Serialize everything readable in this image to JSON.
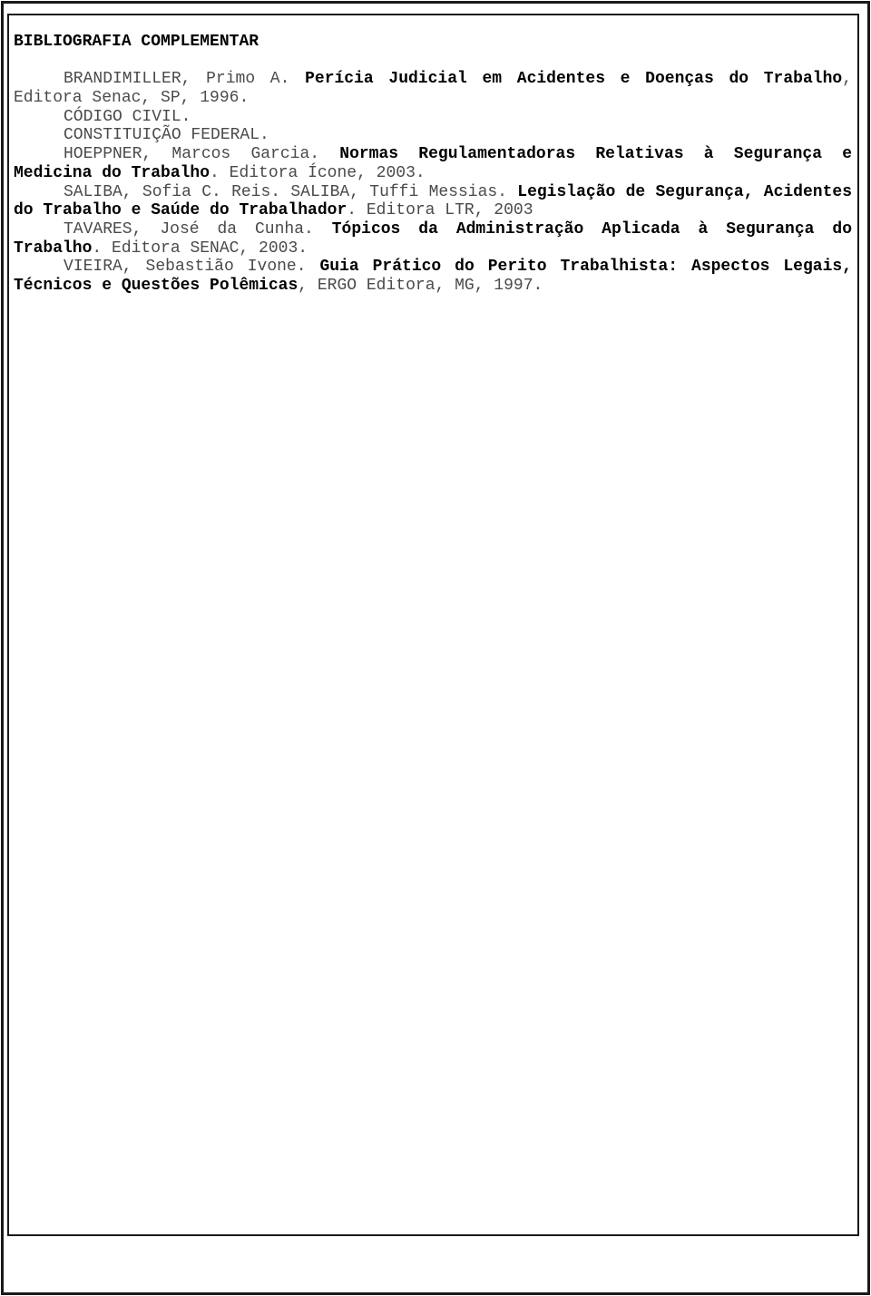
{
  "document": {
    "section_title": "BIBLIOGRAFIA COMPLEMENTAR",
    "references": [
      {
        "author": "BRANDIMILLER, Primo A. ",
        "title": "Perícia Judicial em Acidentes e Doenças do Trabalho",
        "publication": ", Editora Senac, SP, 1996."
      },
      {
        "author": "CÓDIGO CIVIL.",
        "title": "",
        "publication": ""
      },
      {
        "author": "CONSTITUIÇÃO FEDERAL.",
        "title": "",
        "publication": ""
      },
      {
        "author": "HOEPPNER, Marcos Garcia. ",
        "title": "Normas Regulamentadoras Relativas à Segurança e Medicina do Trabalho",
        "publication": ". Editora Ícone, 2003."
      },
      {
        "author": "SALIBA, Sofia C. Reis. SALIBA, Tuffi Messias. ",
        "title": "Legislação de Segurança, Acidentes do Trabalho e Saúde do Trabalhador",
        "publication": ". Editora LTR, 2003"
      },
      {
        "author": "TAVARES, José da Cunha. ",
        "title": "Tópicos da Administração Aplicada à Segurança do Trabalho",
        "publication": ". Editora SENAC, 2003."
      },
      {
        "author": "VIEIRA, Sebastião Ivone. ",
        "title": "Guia Prático do Perito Trabalhista: Aspectos Legais, Técnicos e Questões Polêmicas",
        "publication": ", ERGO Editora, MG, 1997."
      }
    ]
  }
}
